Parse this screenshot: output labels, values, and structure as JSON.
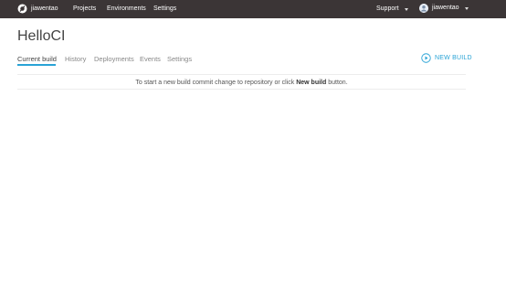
{
  "topbar": {
    "user_name": "jiawentao",
    "nav": [
      "Projects",
      "Environments",
      "Settings"
    ],
    "support_label": "Support",
    "account_name": "jiawentao"
  },
  "page": {
    "title": "HelloCI",
    "tabs": [
      "Current build",
      "History",
      "Deployments",
      "Events",
      "Settings"
    ],
    "active_tab": "Current build",
    "new_build_label": "NEW BUILD"
  },
  "empty_state": {
    "text_before": "To start a new build commit change to repository or click ",
    "emphasis": "New build",
    "text_after": " button."
  },
  "colors": {
    "topbar_bg": "#3b3536",
    "accent": "#29a3d6"
  }
}
